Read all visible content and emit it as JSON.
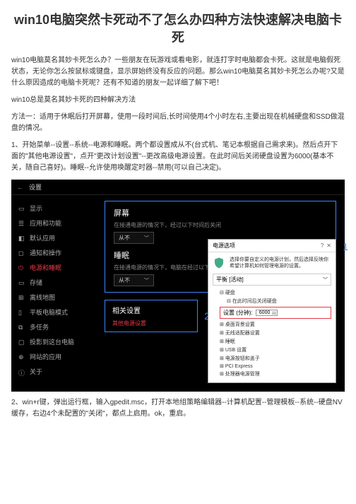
{
  "title": "win10电脑突然卡死动不了怎么办四种方法快速解决电脑卡死",
  "intro": "win10电脑莫名其妙卡死怎么办？一些朋友在玩游戏或看电影，就连打字时电脑都会卡死。这就是电脑假死状态，无论你怎么按鼠标或键盘，显示屏始终没有反应的问题。那么win10电脑莫名其妙卡死怎么办呢?又是什么原因造成的电脑卡死呢？还有不知道的朋友一起详细了解下吧！",
  "sub1": "win10总是莫名其妙卡死的四种解决方法",
  "m1_title": "方法一：适用于休眠后打开屏幕，使用一段时间后,长时间使用4个小时左右,主要出现在机械硬盘和SSD做混盘的情况。",
  "m1_body": "1、开始菜单--设置--系统--电源和睡眠。两个都设置成从不(台式机、笔记本根据自己需求来)。然后点开下面的\"其他电源设置\"，点开\"更改计划设置\"--更改高级电源设置。在此时间后关闭硬盘设置为6000(基本不关，随自己喜好)。睡眠--允许使用唤醒定时器--禁用(可以自己决定)。",
  "shot": {
    "win_title": "设置",
    "sidebar": [
      "显示",
      "应用和功能",
      "默认应用",
      "通知和操作",
      "电源和睡眠",
      "存储",
      "离线地图",
      "平板电脑模式",
      "多任务",
      "投影到这台电脑",
      "网站的应用",
      "关于"
    ],
    "screen_title": "屏幕",
    "screen_sub": "在接通电源的情况下，经过以下时间后关闭",
    "never": "从不",
    "sleep_title": "睡眠",
    "sleep_sub": "在接通电源的情况下，电脑在经过以下时间后进入睡眠状态",
    "num1": "1",
    "rel_title": "相关设置",
    "rel_link": "其他电源设置",
    "num2": "2",
    "dlg_title": "电源选项",
    "dlg_msg": "选择你要自定义的电源计划，然后选择反映你希望计算机如何管理电源的设置。",
    "plan_label": "平衡 [活动]",
    "tree": [
      "硬盘",
      "在此时间后关闭硬盘"
    ],
    "setting_label": "设置 (分钟):",
    "setting_val": "6000",
    "tree2": [
      "桌面背景设置",
      "无线适配器设置",
      "睡眠",
      "USB 设置",
      "电源按钮和盖子",
      "PCI Express",
      "处理器电源管理"
    ]
  },
  "m2": "2、win+r键，弹出运行框，输入gpedit.msc，打开本地组策略编辑器--计算机配置--管理模板--系统--硬盘NV缓存，右边4个未配置的\"关闭\"，都点上启用。ok，重启。"
}
